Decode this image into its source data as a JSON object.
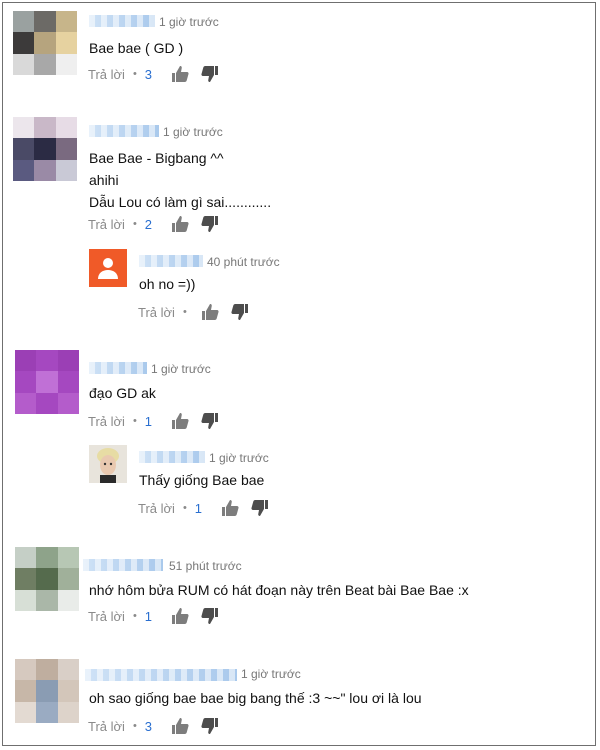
{
  "comments": [
    {
      "time": "1 giờ trước",
      "lines": [
        "Bae bae ( GD )"
      ],
      "reply_label": "Trả lời",
      "dot": "•",
      "likes": "3",
      "avatar_colors": [
        "#9aa1a0",
        "#6c6a66",
        "#c7b58a",
        "#3c3a3a",
        "#b6a47e",
        "#e6d2a0",
        "#d9d9d9",
        "#a8a8a8",
        "#efefef"
      ]
    },
    {
      "time": "1 giờ trước",
      "lines": [
        "Bae Bae - Bigbang ^^",
        "ahihi",
        "Dẫu Lou có làm gì sai............"
      ],
      "reply_label": "Trả lời",
      "dot": "•",
      "likes": "2",
      "avatar_colors": [
        "#ece6ec",
        "#c9b8c8",
        "#e7dce6",
        "#4a4a66",
        "#2b2b44",
        "#7a6a80",
        "#5a5a80",
        "#9a8aa6",
        "#c9c9d6"
      ]
    },
    {
      "time": "40 phút trước",
      "lines": [
        "oh no =))"
      ],
      "reply_label": "Trả lời",
      "dot": "•",
      "likes": "",
      "avatar_colors": []
    },
    {
      "time": "1 giờ trước",
      "lines": [
        "đạo GD ak"
      ],
      "reply_label": "Trả lời",
      "dot": "•",
      "likes": "1",
      "avatar_colors": [
        "#9b3fb5",
        "#a548c0",
        "#9b3fb5",
        "#a548c0",
        "#c070d6",
        "#a548c0",
        "#b45ccb",
        "#a548c0",
        "#b45ccb"
      ]
    },
    {
      "time": "1 giờ trước",
      "lines": [
        "Thấy giống Bae bae"
      ],
      "reply_label": "Trả lời",
      "dot": "•",
      "likes": "1",
      "avatar_colors": []
    },
    {
      "time": "51 phút trước",
      "lines": [
        "nhớ hôm bửa RUM có hát đoạn này trên Beat bài Bae Bae :x"
      ],
      "reply_label": "Trả lời",
      "dot": "•",
      "likes": "1",
      "avatar_colors": [
        "#c5cfc6",
        "#8ea38a",
        "#b7c7b4",
        "#6f7e63",
        "#556b4d",
        "#a0b09a",
        "#d7dfd6",
        "#aab7a8",
        "#e9ece9"
      ]
    },
    {
      "time": "1 giờ trước",
      "lines": [
        "oh sao giống bae bae big bang thế :3 ~~\" lou ơi là lou"
      ],
      "reply_label": "Trả lời",
      "dot": "•",
      "likes": "3",
      "avatar_colors": [
        "#d6c9bf",
        "#bfae9f",
        "#d9cfc7",
        "#c7b7a8",
        "#8a9cb3",
        "#d3c6ba",
        "#e3dad2",
        "#9aabc2",
        "#ddd3ca"
      ]
    }
  ]
}
